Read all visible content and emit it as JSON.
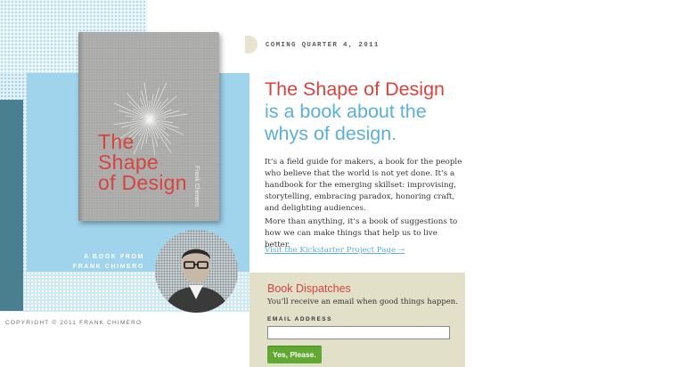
{
  "teaser": {
    "coming": "COMING QUARTER 4, 2011"
  },
  "book": {
    "cover_title_lines": [
      "The",
      "Shape",
      "of Design"
    ],
    "cover_author": "Frank Chimero",
    "from_label_line1": "A BOOK FROM",
    "from_label_line2": "FRANK CHIMERO"
  },
  "headline": {
    "line1": "The Shape of Design",
    "line2": "is a book about the",
    "line3": "whys of design."
  },
  "body": {
    "paragraph1": "It’s a field guide for makers, a book for the people who believe that the world is not yet done. It’s a handbook for the emerging skillset: improvising, storytelling, embracing paradox, honoring craft, and delighting audiences.",
    "paragraph2": "More than anything, it’s a book of suggestions to how we can make things that help us to live better.",
    "kickstarter_link": "Visit the Kickstarter Project Page →"
  },
  "dispatches": {
    "title": "Book Dispatches",
    "subtitle": "You’ll receive an email when good things happen.",
    "email_label": "EMAIL ADDRESS",
    "email_value": "",
    "submit_label": "Yes, Please."
  },
  "footer": {
    "copyright": "COPYRIGHT © 2011 FRANK CHIMERO"
  },
  "colors": {
    "accent_red": "#d8433f",
    "accent_blue": "#5ab0d6",
    "panel_bg": "#e3e0c9",
    "button_green": "#62a933"
  }
}
